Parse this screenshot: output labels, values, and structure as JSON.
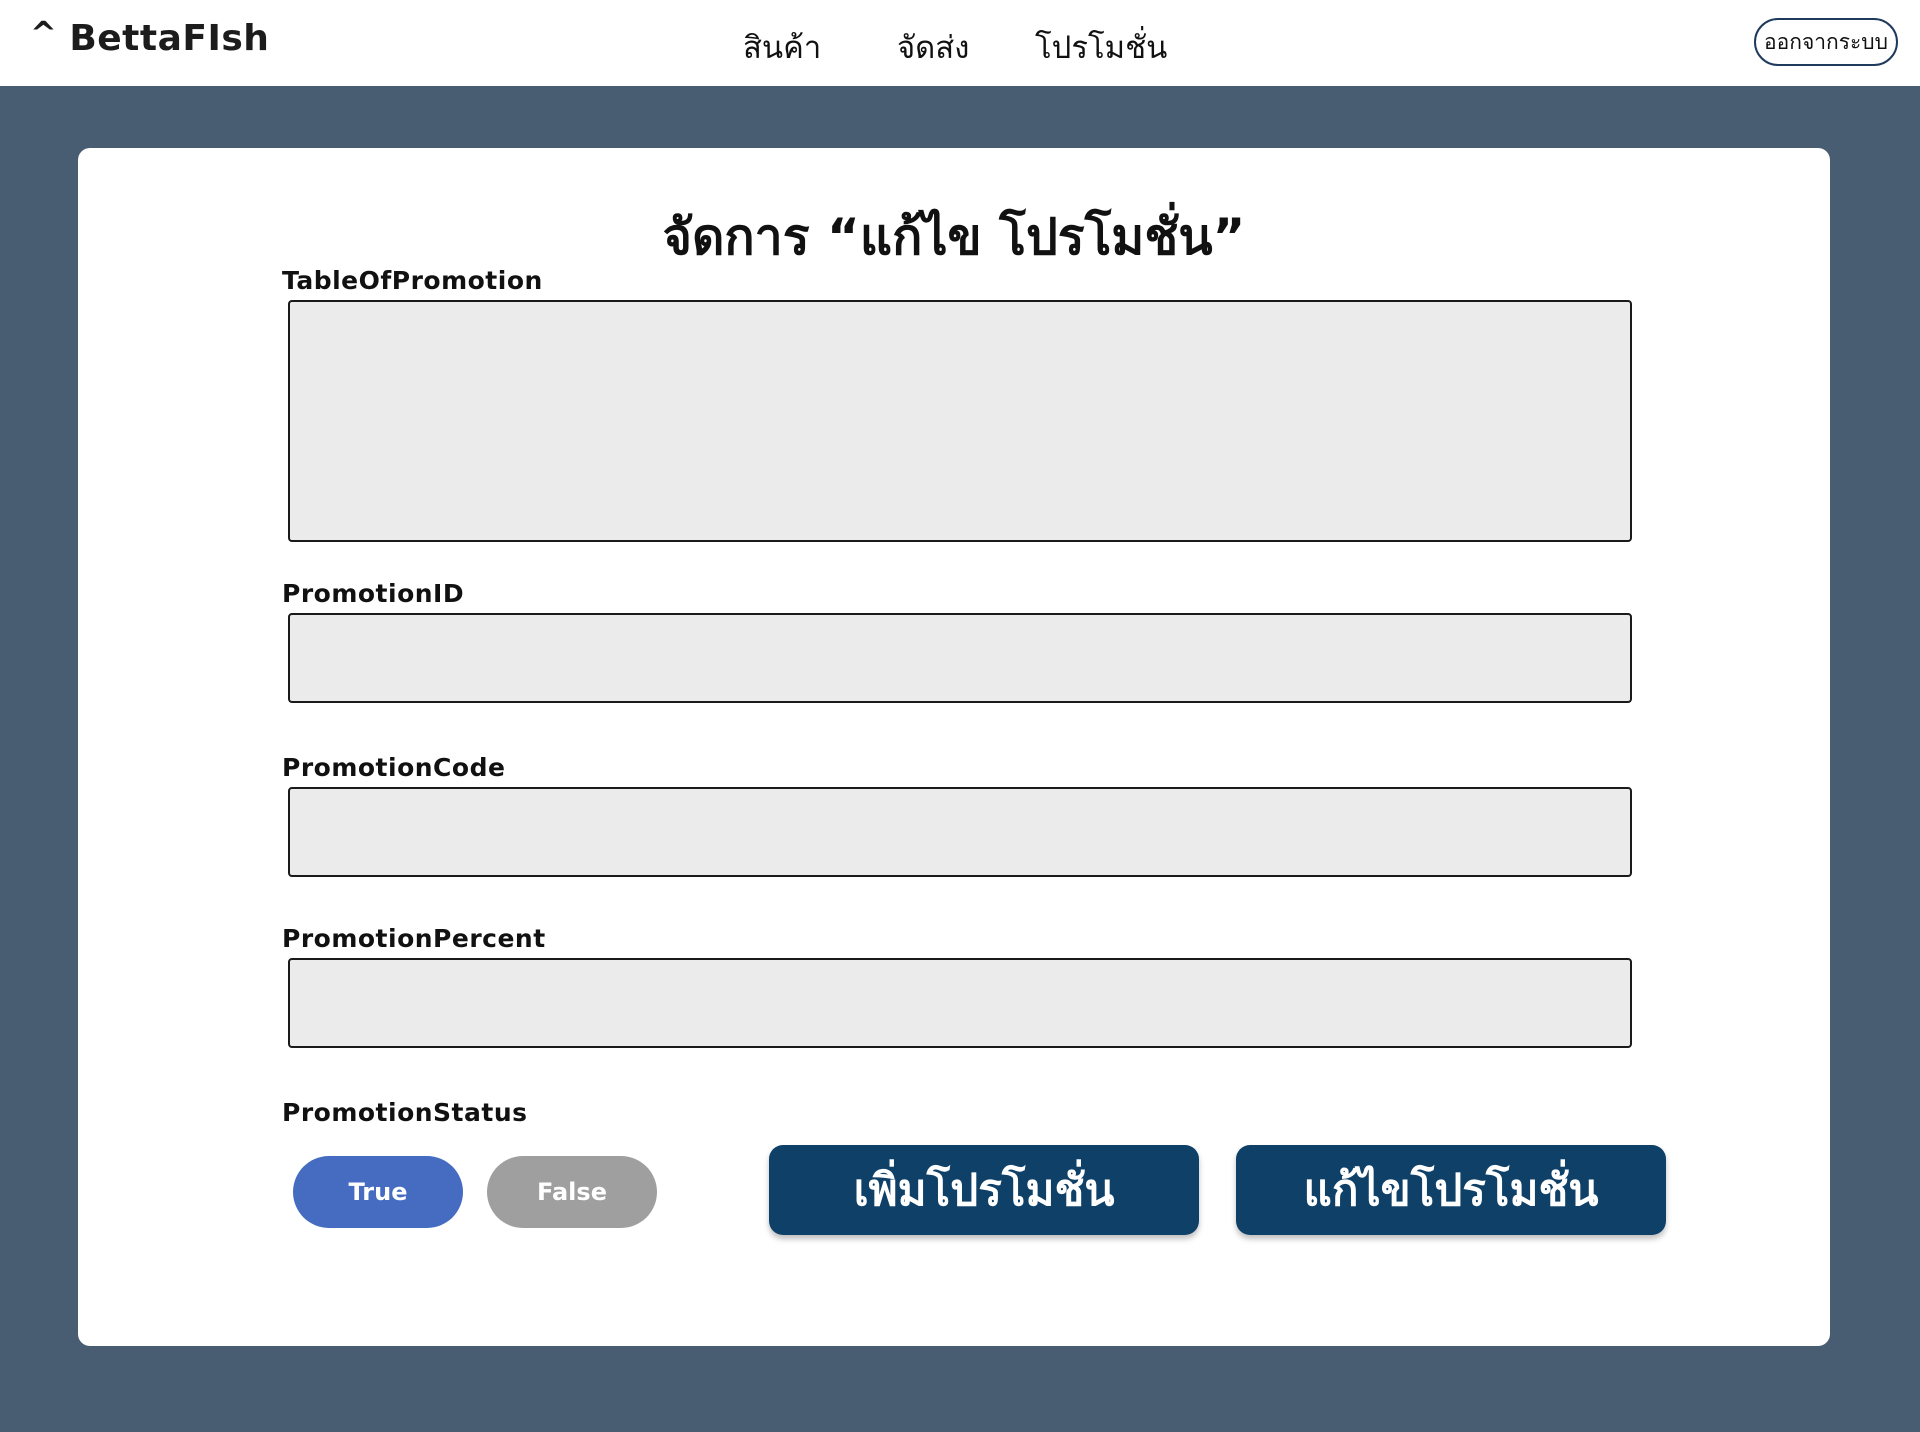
{
  "brand": {
    "caret": "^",
    "name": "BettaFIsh"
  },
  "nav": {
    "items": [
      "สินค้า",
      "จัดส่ง",
      "โปรโมชั่น"
    ]
  },
  "header": {
    "logout_label": "ออกจากระบบ"
  },
  "form": {
    "title": "จัดการ “แก้ไข โปรโมชั่น”",
    "table_label": "TableOfPromotion",
    "id_label": "PromotionID",
    "id_value": "",
    "code_label": "PromotionCode",
    "code_value": "",
    "percent_label": "PromotionPercent",
    "percent_value": "",
    "status_label": "PromotionStatus",
    "status_true": "True",
    "status_false": "False",
    "add_button": "เพิ่มโปรโมชั่น",
    "edit_button": "แก้ไขโปรโมชั่น"
  },
  "colors": {
    "background": "#485d71",
    "primary_button": "#0f4068",
    "true_pill": "#456cc0",
    "false_pill": "#9f9f9f",
    "field_fill": "#ebebeb"
  }
}
